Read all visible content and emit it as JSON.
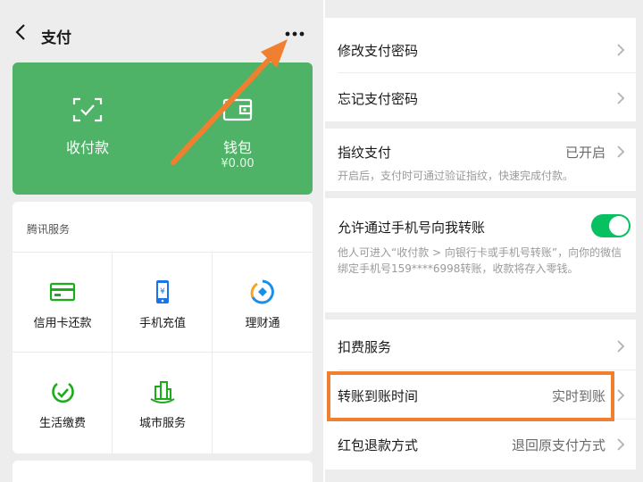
{
  "left": {
    "title": "支付",
    "green_card": {
      "pay_label": "收付款",
      "wallet_label": "钱包",
      "wallet_balance": "¥0.00"
    },
    "services": {
      "header": "腾讯服务",
      "items": [
        {
          "label": "信用卡还款",
          "icon": "credit-card-icon"
        },
        {
          "label": "手机充值",
          "icon": "phone-topup-icon"
        },
        {
          "label": "理财通",
          "icon": "wealth-icon"
        },
        {
          "label": "生活缴费",
          "icon": "utility-bill-icon"
        },
        {
          "label": "城市服务",
          "icon": "city-service-icon"
        }
      ]
    }
  },
  "right": {
    "rows": {
      "change_password": "修改支付密码",
      "forgot_password": "忘记支付密码",
      "fingerprint": {
        "label": "指纹支付",
        "value": "已开启",
        "desc": "开启后，支付时可通过验证指纹，快速完成付款。"
      },
      "phone_transfer": {
        "label": "允许通过手机号向我转账",
        "enabled": true,
        "desc": "他人可进入“收付款 > 向银行卡或手机号转账”，向你的微信绑定手机号159****6998转账，收款将存入零钱。"
      },
      "deduction": "扣费服务",
      "transfer_time": {
        "label": "转账到账时间",
        "value": "实时到账"
      },
      "red_packet_refund": {
        "label": "红包退款方式",
        "value": "退回原支付方式"
      }
    }
  },
  "colors": {
    "green_card": "#4fb367",
    "icon_green": "#1aad19",
    "toggle_on": "#07c160",
    "arrow": "#f08030",
    "highlight": "#f08030",
    "background": "#ededed"
  }
}
